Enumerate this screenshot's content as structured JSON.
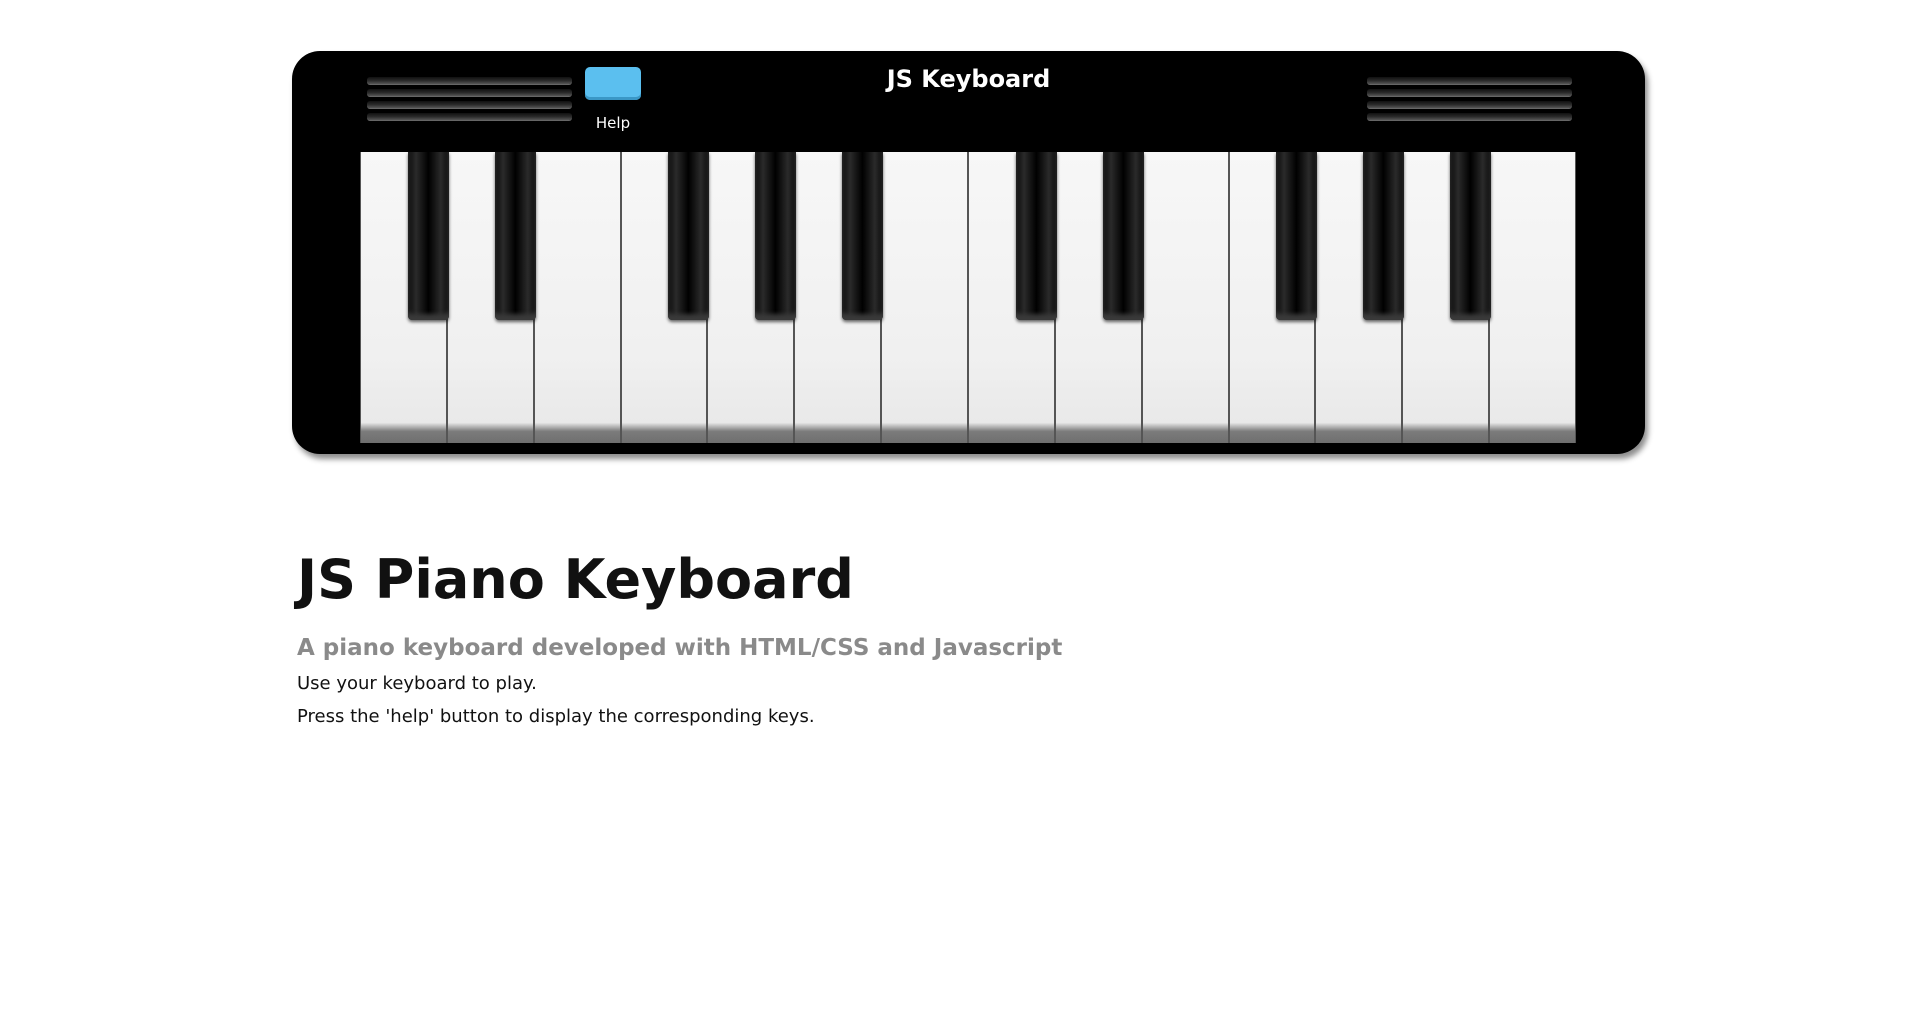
{
  "piano": {
    "title": "JS Keyboard",
    "help_label": "Help",
    "help_button_color": "#5bbfef",
    "white_key_count": 14,
    "white_keys": [
      "C",
      "D",
      "E",
      "F",
      "G",
      "A",
      "B",
      "C",
      "D",
      "E",
      "F",
      "G",
      "A",
      "B"
    ],
    "black_keys": [
      "C#",
      "D#",
      "F#",
      "G#",
      "A#",
      "C#",
      "D#",
      "F#",
      "G#",
      "A#"
    ]
  },
  "content": {
    "title": "JS Piano Keyboard",
    "subtitle": "A piano keyboard developed with HTML/CSS and Javascript",
    "instruction_1": "Use your keyboard to play.",
    "instruction_2": "Press the 'help' button to display the corresponding keys."
  }
}
